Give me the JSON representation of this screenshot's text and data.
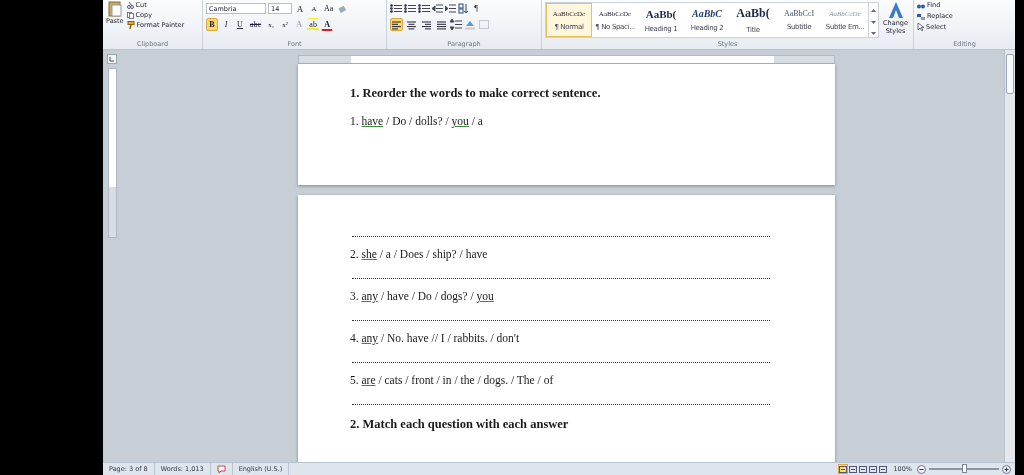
{
  "ribbon": {
    "clipboard": {
      "label": "Clipboard",
      "paste": "Paste",
      "cut": "Cut",
      "copy": "Copy",
      "format_painter": "Format Painter"
    },
    "font": {
      "label": "Font",
      "font_name": "Cambria",
      "font_size": "14",
      "size_buttons": [
        "A",
        "A"
      ],
      "change_case": "Aa",
      "format_buttons": [
        {
          "kind": "bold",
          "text": "B",
          "active": true
        },
        {
          "kind": "italic",
          "text": "I",
          "active": false
        },
        {
          "kind": "underline",
          "text": "U",
          "active": false
        },
        {
          "kind": "strike",
          "text": "abc",
          "active": false
        },
        {
          "kind": "subscript",
          "text": "x₂",
          "active": false
        },
        {
          "kind": "superscript",
          "text": "x²",
          "active": false
        }
      ],
      "color_buttons": [
        {
          "kind": "effects",
          "text": "A"
        },
        {
          "kind": "highlight",
          "text": "ab"
        },
        {
          "kind": "font_color",
          "text": "A"
        }
      ]
    },
    "paragraph": {
      "label": "Paragraph",
      "pilcrow": "¶",
      "align": [
        {
          "kind": "left",
          "selected": true
        },
        {
          "kind": "center",
          "selected": false
        },
        {
          "kind": "right",
          "selected": false
        },
        {
          "kind": "justify",
          "selected": false
        }
      ]
    },
    "styles": {
      "label": "Styles",
      "change_styles": "Change Styles",
      "items": [
        {
          "kind": "normal",
          "preview": "AaBbCcDc",
          "name": "¶ Normal",
          "selected": true
        },
        {
          "kind": "normal",
          "preview": "AaBbCcDc",
          "name": "¶ No Spaci...",
          "selected": false
        },
        {
          "kind": "heading1",
          "preview": "AaBb(",
          "name": "Heading 1",
          "selected": false
        },
        {
          "kind": "heading2",
          "preview": "AaBbC",
          "name": "Heading 2",
          "selected": false
        },
        {
          "kind": "title",
          "preview": "AaBb(",
          "name": "Title",
          "selected": false
        },
        {
          "kind": "subtitle",
          "preview": "AaBbCcI",
          "name": "Subtitle",
          "selected": false
        },
        {
          "kind": "subtle",
          "preview": "AaBbCcDc",
          "name": "Subtle Em...",
          "selected": false
        }
      ]
    },
    "editing": {
      "label": "Editing",
      "find": "Find",
      "replace": "Replace",
      "select": "Select"
    }
  },
  "pages": [
    {
      "blocks": [
        {
          "kind": "heading",
          "text": "1. Reorder the words to make correct sentence."
        },
        {
          "kind": "exercise",
          "parts": [
            {
              "text": "1. ",
              "flagged": false
            },
            {
              "text": "have",
              "flagged": true
            },
            {
              "text": " / Do / dolls? / ",
              "flagged": false
            },
            {
              "text": "you",
              "flagged": true
            },
            {
              "text": " / a",
              "flagged": false
            }
          ]
        }
      ]
    },
    {
      "blocks": [
        {
          "kind": "answer_line"
        },
        {
          "kind": "exercise",
          "parts": [
            {
              "text": "2. ",
              "flagged": false
            },
            {
              "text": "she",
              "flagged": true
            },
            {
              "text": " / a / Does / ship? / have",
              "flagged": false
            }
          ]
        },
        {
          "kind": "answer_line"
        },
        {
          "kind": "exercise",
          "parts": [
            {
              "text": "3. ",
              "flagged": false
            },
            {
              "text": "any",
              "flagged": true
            },
            {
              "text": " / have / Do / dogs? / ",
              "flagged": false
            },
            {
              "text": "you",
              "flagged": true
            }
          ]
        },
        {
          "kind": "answer_line"
        },
        {
          "kind": "exercise",
          "parts": [
            {
              "text": "4. ",
              "flagged": false
            },
            {
              "text": "any",
              "flagged": true
            },
            {
              "text": " / No. have // I / rabbits. / don't",
              "flagged": false
            }
          ]
        },
        {
          "kind": "answer_line"
        },
        {
          "kind": "exercise",
          "parts": [
            {
              "text": "5. ",
              "flagged": false
            },
            {
              "text": "are",
              "flagged": true
            },
            {
              "text": " / cats / front / in / the / dogs. / The / of",
              "flagged": false
            }
          ]
        },
        {
          "kind": "answer_line"
        },
        {
          "kind": "heading",
          "text": "2. Match each question with each answer"
        }
      ]
    }
  ],
  "status_bar": {
    "page": "Page: 3 of 8",
    "words": "Words: 1,013",
    "language": "English (U.S.)",
    "views": [
      {
        "selected": true
      },
      {
        "selected": false
      },
      {
        "selected": false
      },
      {
        "selected": false
      },
      {
        "selected": false
      }
    ],
    "zoom": "100%",
    "zoom_slider": {
      "level": 0.5
    }
  }
}
